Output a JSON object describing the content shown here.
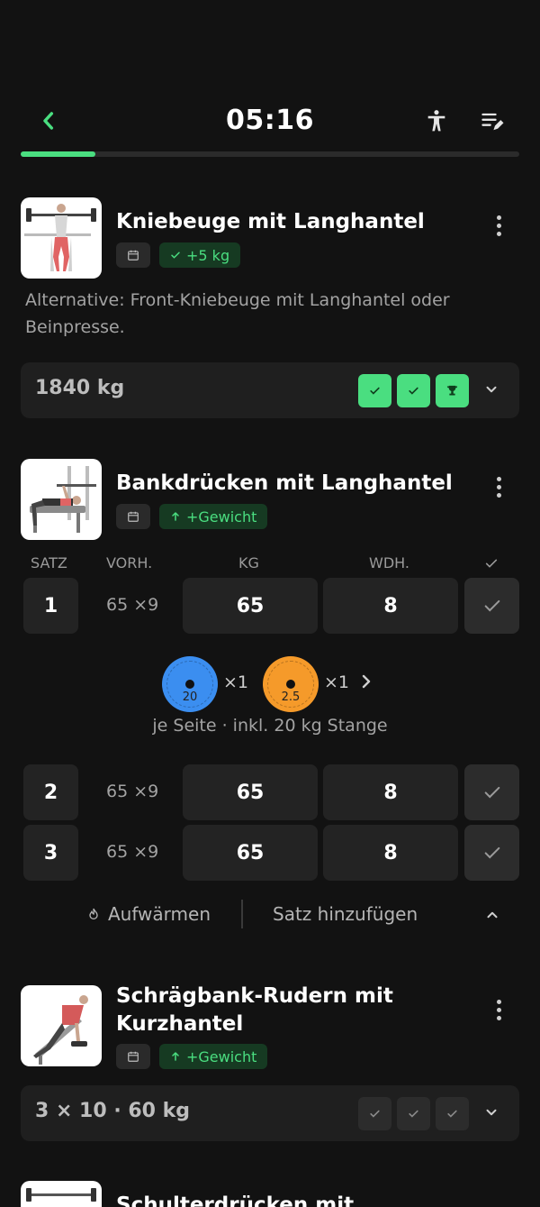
{
  "header": {
    "timer": "05:16",
    "progress": 0.15,
    "icons": [
      "back-chevron-icon",
      "body-figure-icon",
      "edit-list-icon"
    ]
  },
  "exercises": [
    {
      "title": "Kniebeuge mit Langhantel",
      "badge": "+5 kg",
      "badge_icon": "check-icon",
      "note": "Alternative: Front-Kniebeuge mit Langhantel oder Beinpresse.",
      "summary": "1840 kg",
      "checks": [
        "done",
        "done",
        "trophy"
      ]
    },
    {
      "title": "Bankdrücken mit Langhantel",
      "badge": "+Gewicht",
      "badge_icon": "arrow-up-icon",
      "columns": {
        "set": "SATZ",
        "prev": "VORH.",
        "kg": "KG",
        "reps": "WDH."
      },
      "sets": [
        {
          "num": "1",
          "prev": "65 ×9",
          "kg": "65",
          "reps": "8"
        },
        {
          "num": "2",
          "prev": "65 ×9",
          "kg": "65",
          "reps": "8"
        },
        {
          "num": "3",
          "prev": "65 ×9",
          "kg": "65",
          "reps": "8"
        }
      ],
      "plates": [
        {
          "label": "20",
          "count": "×1",
          "color": "#3b8ef0"
        },
        {
          "label": "2.5",
          "count": "×1",
          "color": "#f59a2a"
        }
      ],
      "plate_note": "je Seite · inkl. 20 kg Stange",
      "warmup_label": "Aufwärmen",
      "add_set_label": "Satz hinzufügen"
    },
    {
      "title": "Schrägbank-Rudern mit Kurzhantel",
      "badge": "+Gewicht",
      "badge_icon": "arrow-up-icon",
      "summary": "3 × 10 · 60 kg",
      "checks": [
        "pending",
        "pending",
        "pending"
      ]
    },
    {
      "title": "Schulterdrücken mit Langhantel"
    }
  ],
  "colors": {
    "accent": "#4ade80",
    "background": "#121212",
    "surface": "#232323"
  }
}
